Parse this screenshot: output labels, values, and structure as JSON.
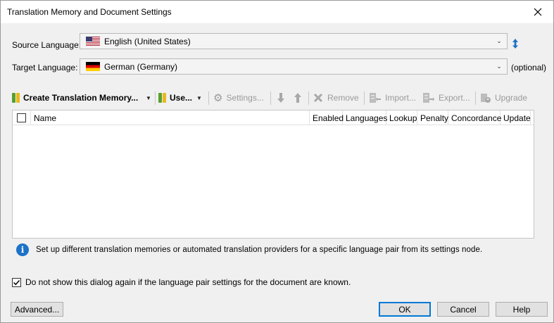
{
  "window": {
    "title": "Translation Memory and Document Settings"
  },
  "source": {
    "label": "Source Language:",
    "value": "English (United States)",
    "flag": "us-flag"
  },
  "target": {
    "label": "Target Language:",
    "value": "German (Germany)",
    "flag": "de-flag",
    "optional_label": "(optional)"
  },
  "toolbar": {
    "create_tm": "Create Translation Memory...",
    "use": "Use...",
    "settings": "Settings...",
    "remove": "Remove",
    "import": "Import...",
    "export": "Export...",
    "upgrade": "Upgrade"
  },
  "table": {
    "columns": [
      "Name",
      "Enabled",
      "Languages",
      "Lookup",
      "Penalty",
      "Concordance",
      "Update"
    ],
    "rows": []
  },
  "info": {
    "text": "Set up different translation memories or automated translation providers for a specific language pair from its settings node."
  },
  "dont_show": {
    "label": "Do not show this dialog again if the language pair settings for the document are known.",
    "checked": true
  },
  "buttons": {
    "advanced": "Advanced...",
    "ok": "OK",
    "cancel": "Cancel",
    "help": "Help"
  },
  "colors": {
    "accent": "#0078d7",
    "info_blue": "#1e72c8",
    "disabled_text": "#9a9a9a",
    "tm_green": "#5aa02c",
    "tm_yellow": "#e8b820"
  }
}
